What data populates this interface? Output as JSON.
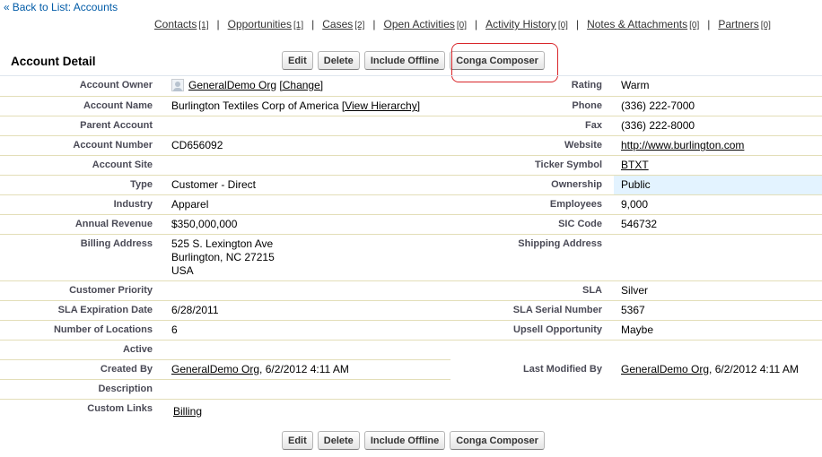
{
  "back_link": {
    "arrow": "«",
    "label": "Back to List: Accounts"
  },
  "related_lists": [
    {
      "name": "Contacts",
      "count": "[1]"
    },
    {
      "name": "Opportunities",
      "count": "[1]"
    },
    {
      "name": "Cases",
      "count": "[2]"
    },
    {
      "name": "Open Activities",
      "count": "[0]"
    },
    {
      "name": "Activity History",
      "count": "[0]"
    },
    {
      "name": "Notes & Attachments",
      "count": "[0]"
    },
    {
      "name": "Partners",
      "count": "[0]"
    }
  ],
  "separator": "|",
  "section_title": "Account Detail",
  "buttons": {
    "edit": "Edit",
    "delete": "Delete",
    "include_offline": "Include Offline",
    "conga": "Conga Composer"
  },
  "fields": {
    "account_owner": {
      "label": "Account Owner",
      "name": "GeneralDemo Org",
      "change": "[Change]"
    },
    "rating": {
      "label": "Rating",
      "value": "Warm"
    },
    "account_name": {
      "label": "Account Name",
      "value": "Burlington Textiles Corp of America",
      "hierarchy": "[View Hierarchy]"
    },
    "phone": {
      "label": "Phone",
      "value": "(336) 222-7000"
    },
    "parent_account": {
      "label": "Parent Account",
      "value": ""
    },
    "fax": {
      "label": "Fax",
      "value": "(336) 222-8000"
    },
    "account_number": {
      "label": "Account Number",
      "value": "CD656092"
    },
    "website": {
      "label": "Website",
      "value": "http://www.burlington.com"
    },
    "account_site": {
      "label": "Account Site",
      "value": ""
    },
    "ticker_symbol": {
      "label": "Ticker Symbol",
      "value": "BTXT"
    },
    "type": {
      "label": "Type",
      "value": "Customer - Direct"
    },
    "ownership": {
      "label": "Ownership",
      "value": "Public"
    },
    "industry": {
      "label": "Industry",
      "value": "Apparel"
    },
    "employees": {
      "label": "Employees",
      "value": "9,000"
    },
    "annual_revenue": {
      "label": "Annual Revenue",
      "value": "$350,000,000"
    },
    "sic_code": {
      "label": "SIC Code",
      "value": "546732"
    },
    "billing_address": {
      "label": "Billing Address",
      "line1": "525 S. Lexington Ave",
      "line2": "Burlington, NC 27215",
      "line3": "USA"
    },
    "shipping_address": {
      "label": "Shipping Address",
      "value": ""
    },
    "customer_priority": {
      "label": "Customer Priority",
      "value": ""
    },
    "sla": {
      "label": "SLA",
      "value": "Silver"
    },
    "sla_expiration": {
      "label": "SLA Expiration Date",
      "value": "6/28/2011"
    },
    "sla_serial": {
      "label": "SLA Serial Number",
      "value": "5367"
    },
    "num_locations": {
      "label": "Number of Locations",
      "value": "6"
    },
    "upsell": {
      "label": "Upsell Opportunity",
      "value": "Maybe"
    },
    "active": {
      "label": "Active",
      "value": ""
    },
    "created_by": {
      "label": "Created By",
      "name": "GeneralDemo Org",
      "date": ", 6/2/2012 4:11 AM"
    },
    "last_modified_by": {
      "label": "Last Modified By",
      "name": "GeneralDemo Org",
      "date": ", 6/2/2012 4:11 AM"
    },
    "description": {
      "label": "Description",
      "value": ""
    },
    "custom_links": {
      "label": "Custom Links",
      "link": "Billing"
    }
  }
}
